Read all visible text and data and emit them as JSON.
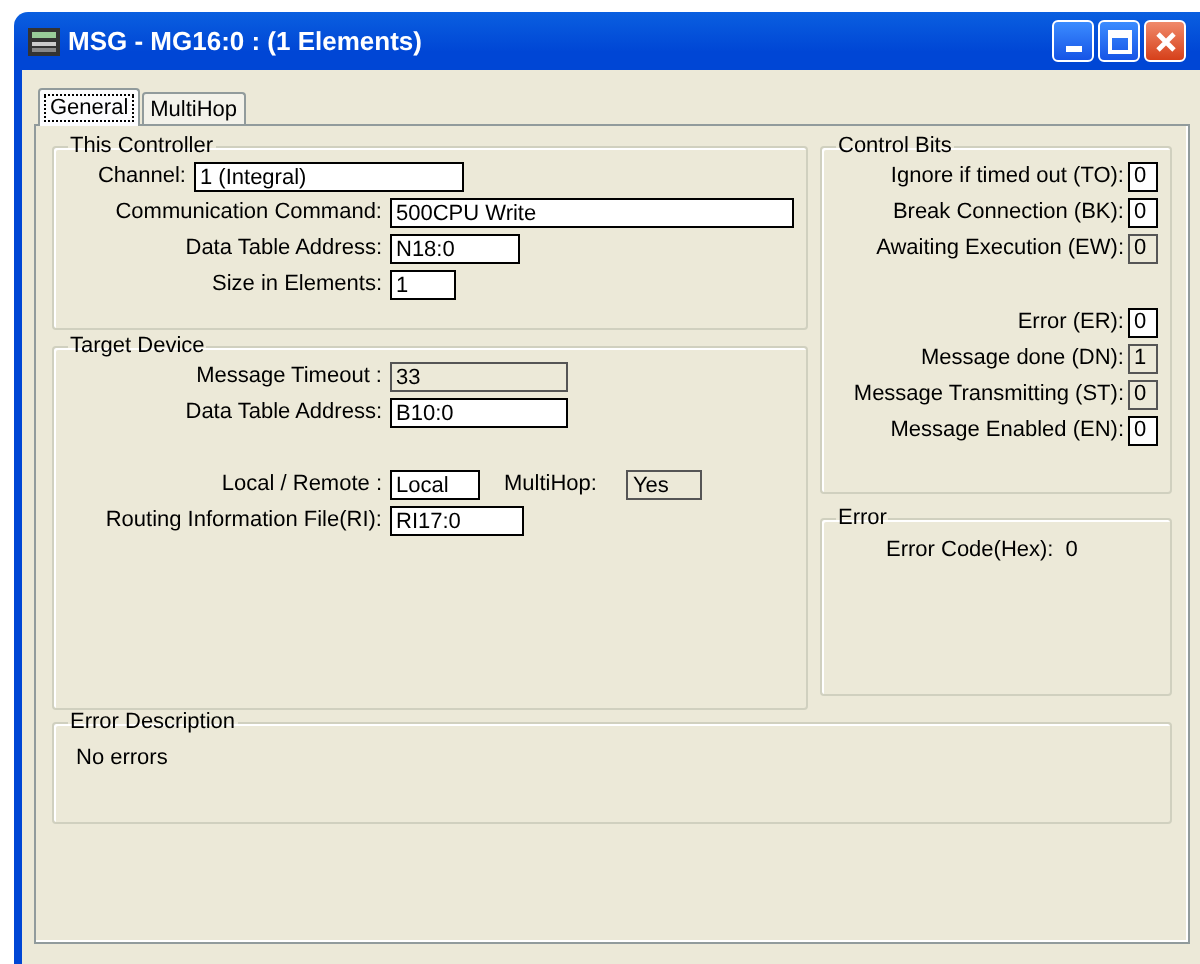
{
  "window": {
    "title": "MSG - MG16:0 : (1 Elements)"
  },
  "tabs": [
    {
      "label": "General",
      "selected": true
    },
    {
      "label": "MultiHop",
      "selected": false
    }
  ],
  "this_controller": {
    "title": "This Controller",
    "fields": [
      {
        "label": "Channel:",
        "value": "1 (Integral)",
        "readonly": false
      },
      {
        "label": "Communication Command:",
        "value": "500CPU Write",
        "readonly": false
      },
      {
        "label": "Data Table Address:",
        "value": "N18:0",
        "readonly": false
      },
      {
        "label": "Size in Elements:",
        "value": "1",
        "readonly": false
      }
    ]
  },
  "target_device": {
    "title": "Target Device",
    "fields": [
      {
        "label": "Message Timeout :",
        "value": "33",
        "readonly": true
      },
      {
        "label": "Data Table Address:",
        "value": "B10:0",
        "readonly": false
      },
      {
        "label": "Local / Remote :",
        "value": "Local",
        "readonly": false
      },
      {
        "label": "MultiHop:",
        "value": "Yes",
        "readonly": true
      },
      {
        "label": "Routing Information File(RI):",
        "value": "RI17:0",
        "readonly": false
      }
    ]
  },
  "control_bits": {
    "title": "Control Bits",
    "bits": [
      {
        "label": "Ignore if timed out (TO):",
        "value": "0",
        "readonly": false
      },
      {
        "label": "Break Connection (BK):",
        "value": "0",
        "readonly": false
      },
      {
        "label": "Awaiting Execution (EW):",
        "value": "0",
        "readonly": true
      },
      {
        "label": "Error (ER):",
        "value": "0",
        "readonly": false
      },
      {
        "label": "Message done (DN):",
        "value": "1",
        "readonly": true
      },
      {
        "label": "Message Transmitting (ST):",
        "value": "0",
        "readonly": true
      },
      {
        "label": "Message Enabled (EN):",
        "value": "0",
        "readonly": false
      }
    ]
  },
  "error": {
    "title": "Error",
    "label": "Error Code(Hex):",
    "value": "0"
  },
  "error_description": {
    "title": "Error Description",
    "text": "No errors"
  }
}
